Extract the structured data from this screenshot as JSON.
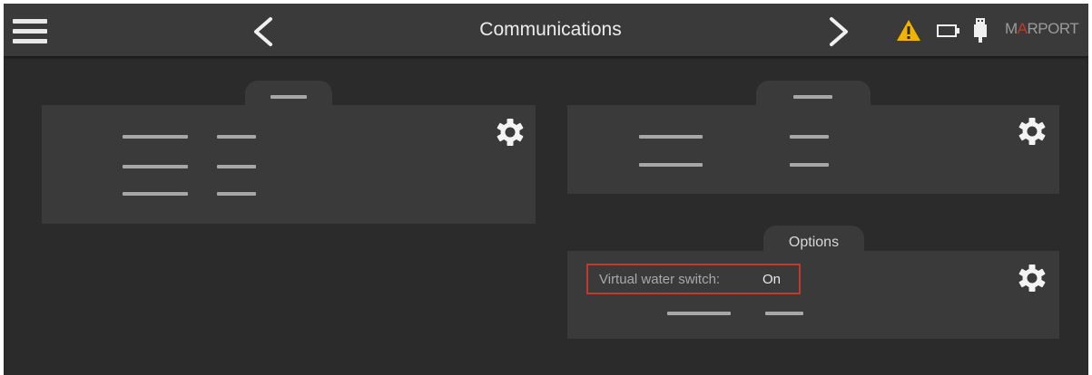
{
  "header": {
    "title": "Communications",
    "menu_icon": "hamburger-menu-icon",
    "prev_icon": "chevron-left-icon",
    "next_icon": "chevron-right-icon",
    "status_icons": [
      "warning-icon",
      "battery-icon",
      "usb-icon"
    ],
    "brand": {
      "prefix": "M",
      "accent": "A",
      "suffix": "RPORT"
    }
  },
  "panels": {
    "options": {
      "tab_label": "Options",
      "setting_label": "Virtual water switch:",
      "setting_value": "On"
    }
  },
  "colors": {
    "background": "#2b2b2b",
    "panel": "#3a3a3a",
    "warning": "#f2b200",
    "highlight": "#c0392b",
    "placeholder": "#a7a7a7"
  }
}
